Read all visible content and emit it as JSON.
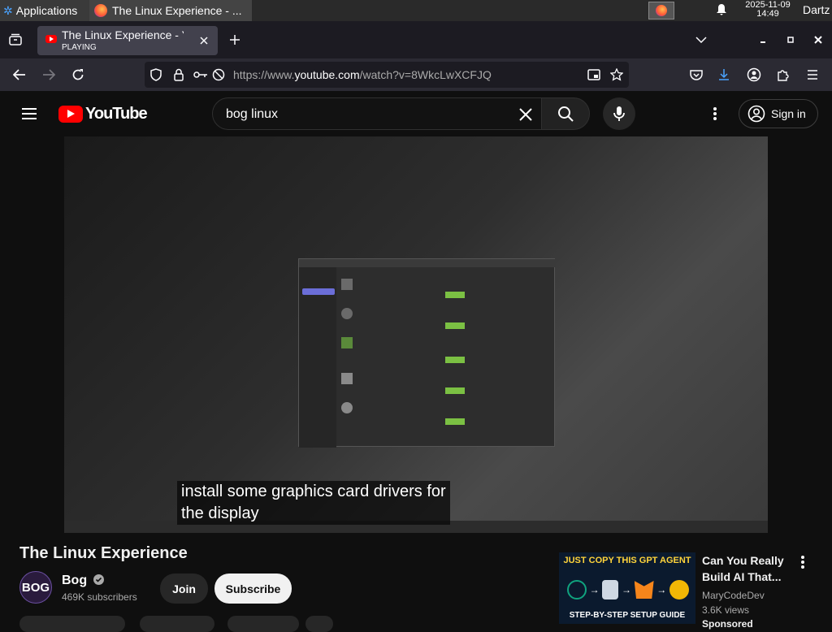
{
  "taskbar": {
    "apps_label": "Applications",
    "window_title": "The Linux Experience - ...",
    "clock_date": "2025-11-09",
    "clock_time": "14:49",
    "user": "Dartz"
  },
  "browser": {
    "tab_title": "The Linux Experience - YouTube",
    "tab_status": "PLAYING",
    "url_prefix": "https://www.",
    "url_domain": "youtube.com",
    "url_path": "/watch?v=8WkcLwXCFJQ"
  },
  "youtube": {
    "logo_text": "YouTube",
    "search_value": "bog linux",
    "signin_label": "Sign in"
  },
  "video": {
    "caption_line1": "install some graphics card drivers for",
    "caption_line2": "the display"
  },
  "meta": {
    "title": "The Linux Experience",
    "channel": "Bog",
    "avatar_text": "BOG",
    "subscribers": "469K subscribers",
    "join_label": "Join",
    "subscribe_label": "Subscribe"
  },
  "recommendation": {
    "thumb_top": "JUST COPY THIS GPT AGENT",
    "thumb_bottom": "STEP-BY-STEP SETUP GUIDE",
    "title": "Can You Really Build AI That...",
    "channel": "MaryCodeDev",
    "views": "3.6K views",
    "sponsored": "Sponsored"
  },
  "colors": {
    "youtube_red": "#ff0000",
    "subscribe_bg": "#f1f1f1",
    "page_bg": "#0f0f0f"
  }
}
